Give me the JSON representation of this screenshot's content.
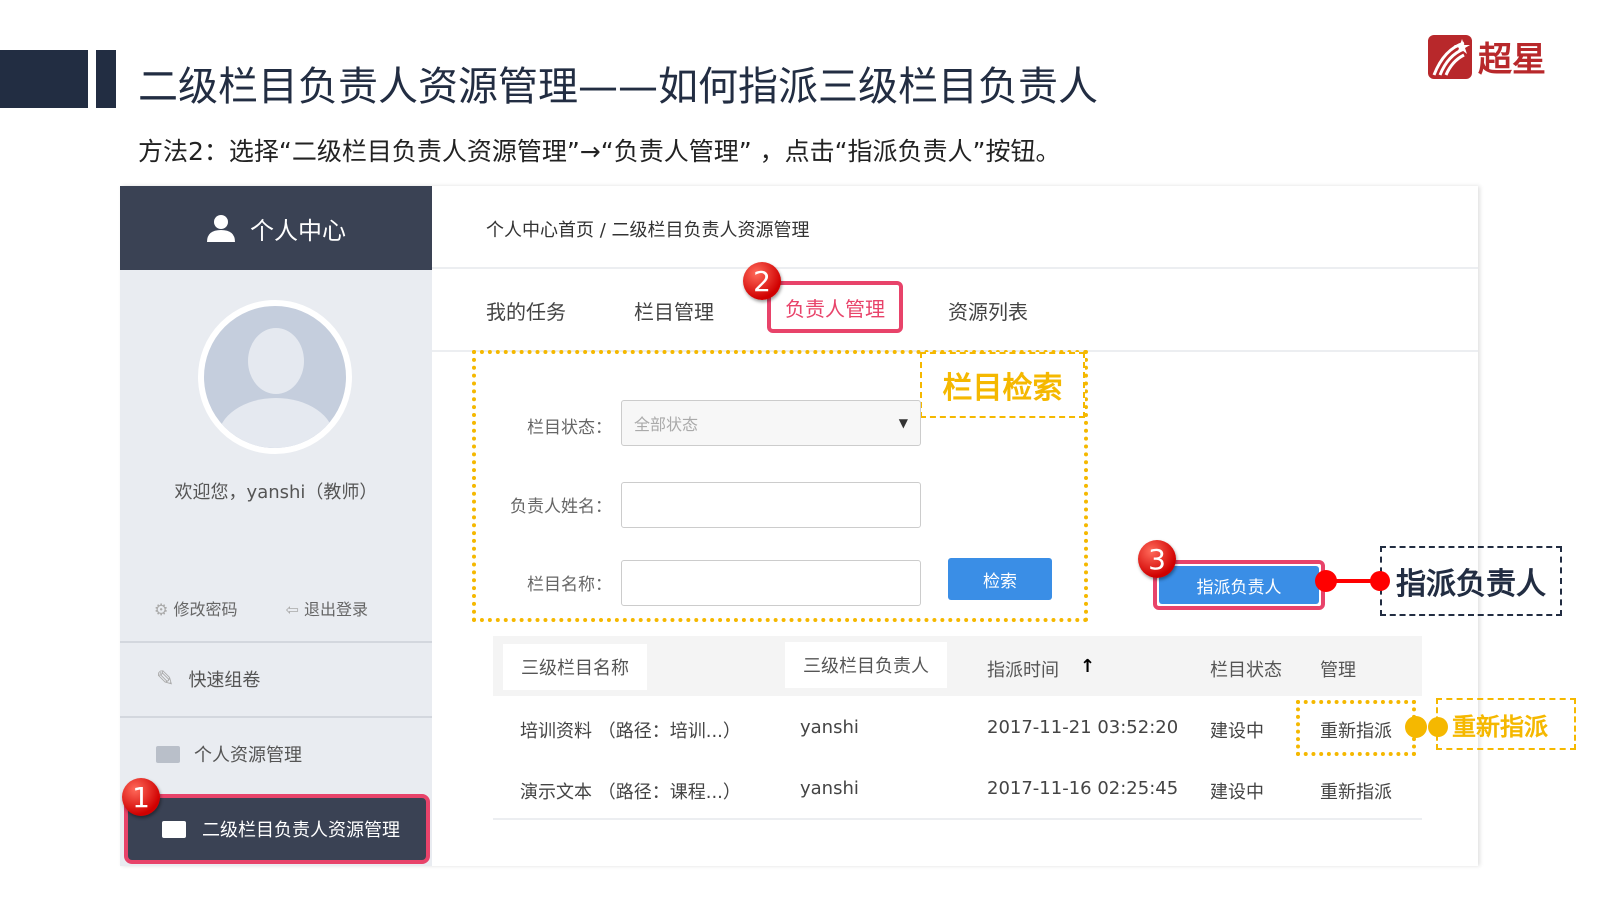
{
  "slide": {
    "title": "二级栏目负责人资源管理——如何指派三级栏目负责人",
    "subtitle": "方法2：选择“二级栏目负责人资源管理”→“负责人管理” ，点击“指派负责人”按钮。",
    "logo_text": "超星",
    "brand_color": "#b8282b",
    "accent_color": "#222d42"
  },
  "sidebar": {
    "header": "个人中心",
    "welcome": "欢迎您，yanshi（教师）",
    "change_password": "修改密码",
    "logout": "退出登录",
    "items": [
      {
        "label": "快速组卷",
        "icon": "edit-icon"
      },
      {
        "label": "个人资源管理",
        "icon": "folder-icon"
      },
      {
        "label": "二级栏目负责人资源管理",
        "icon": "folder-icon",
        "active": true
      }
    ]
  },
  "breadcrumb": "个人中心首页 / 二级栏目负责人资源管理",
  "tabs": [
    {
      "label": "我的任务"
    },
    {
      "label": "栏目管理"
    },
    {
      "label": "负责人管理",
      "active": true
    },
    {
      "label": "资源列表"
    }
  ],
  "search": {
    "tag": "栏目检索",
    "status_label": "栏目状态：",
    "status_value": "全部状态",
    "owner_label": "负责人姓名：",
    "owner_value": "",
    "name_label": "栏目名称：",
    "name_value": "",
    "button": "检索"
  },
  "assign_button": "指派负责人",
  "callouts": {
    "assign": "指派负责人",
    "reassign": "重新指派",
    "step1": "1",
    "step2": "2",
    "step3": "3"
  },
  "table": {
    "headers": [
      "三级栏目名称",
      "三级栏目负责人",
      "指派时间",
      "栏目状态",
      "管理"
    ],
    "rows": [
      [
        "培训资料 （路径：培训...）",
        "yanshi",
        "2017-11-21 03:52:20",
        "建设中",
        "重新指派"
      ],
      [
        "演示文本 （路径：课程...）",
        "yanshi",
        "2017-11-16 02:25:45",
        "建设中",
        "重新指派"
      ]
    ]
  }
}
